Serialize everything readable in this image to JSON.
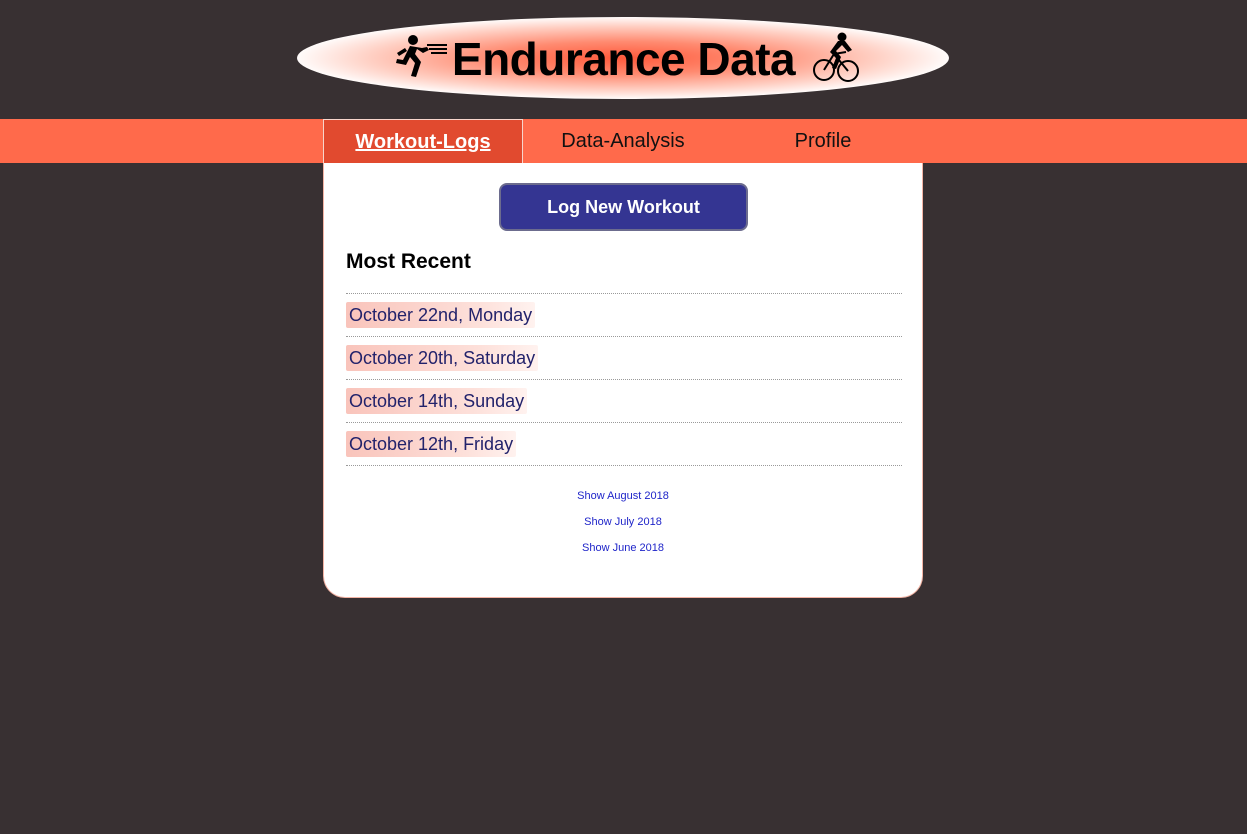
{
  "header": {
    "title": "Endurance Data",
    "left_icon": "runner-icon",
    "right_icon": "cyclist-icon"
  },
  "nav": {
    "tabs": [
      {
        "label": "Workout-Logs",
        "active": true
      },
      {
        "label": "Data-Analysis",
        "active": false
      },
      {
        "label": "Profile",
        "active": false
      }
    ]
  },
  "main": {
    "log_button_label": "Log New Workout",
    "section_title": "Most Recent",
    "workouts": [
      {
        "label": "October 22nd, Monday"
      },
      {
        "label": "October 20th, Saturday"
      },
      {
        "label": "October 14th, Sunday"
      },
      {
        "label": "October 12th, Friday"
      }
    ],
    "month_links": [
      {
        "label": "Show August 2018"
      },
      {
        "label": "Show July 2018"
      },
      {
        "label": "Show June 2018"
      }
    ]
  },
  "colors": {
    "background": "#383032",
    "nav_bar": "#ff6a4b",
    "nav_active": "#e14a2f",
    "button": "#343592",
    "link": "#1f25c9",
    "workout_text": "#22226b"
  }
}
